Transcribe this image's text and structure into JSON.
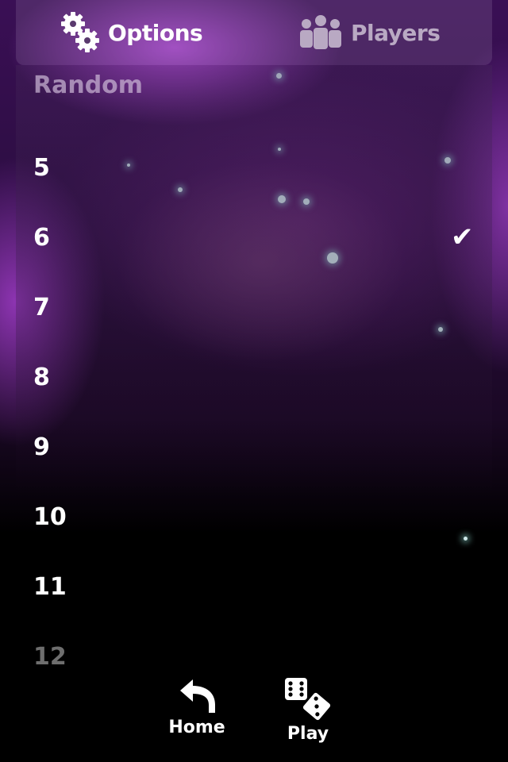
{
  "tabs": {
    "options": {
      "label": "Options",
      "icon": "gears-icon"
    },
    "players": {
      "label": "Players",
      "icon": "people-icon"
    }
  },
  "list": {
    "items": [
      {
        "label": "Random",
        "state": "dim"
      },
      {
        "label": "5"
      },
      {
        "label": "6",
        "checked": true
      },
      {
        "label": "7"
      },
      {
        "label": "8"
      },
      {
        "label": "9"
      },
      {
        "label": "10"
      },
      {
        "label": "11"
      },
      {
        "label": "12",
        "state": "fade"
      }
    ],
    "check_glyph": "✔"
  },
  "bottom": {
    "home_label": "Home",
    "play_label": "Play"
  }
}
